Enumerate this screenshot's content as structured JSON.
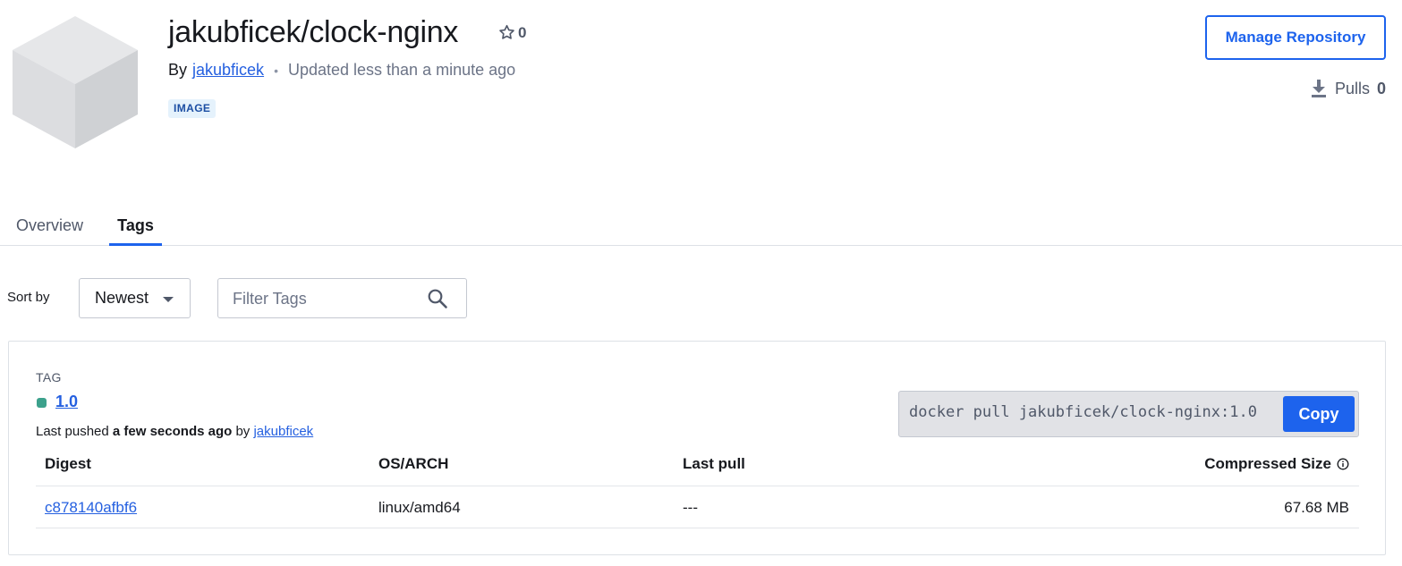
{
  "repo": {
    "name": "jakubficek/clock-nginx",
    "stars": "0",
    "by_label": "By",
    "owner": "jakubficek",
    "updated": "Updated less than a minute ago",
    "badge": "IMAGE",
    "manage_label": "Manage Repository",
    "pulls_label": "Pulls",
    "pulls_count": "0"
  },
  "tabs": [
    {
      "label": "Overview",
      "active": false
    },
    {
      "label": "Tags",
      "active": true
    }
  ],
  "filters": {
    "sort_label": "Sort by",
    "sort_value": "Newest",
    "filter_placeholder": "Filter Tags"
  },
  "tag": {
    "header": "TAG",
    "name": "1.0",
    "status_color": "#3ca18c",
    "pushed_prefix": "Last pushed",
    "pushed_when": "a few seconds ago",
    "pushed_by_label": "by",
    "pushed_by": "jakubficek",
    "pull_command": "docker pull jakubficek/clock-nginx:1.0",
    "copy_label": "Copy",
    "columns": {
      "digest": "Digest",
      "osarch": "OS/ARCH",
      "last_pull": "Last pull",
      "size": "Compressed Size"
    },
    "rows": [
      {
        "digest": "c878140afbf6",
        "osarch": "linux/amd64",
        "last_pull": "---",
        "size": "67.68 MB"
      }
    ]
  },
  "colors": {
    "accent": "#1d63ed",
    "link": "#2560e0"
  },
  "icons": [
    "cube-icon",
    "star-icon",
    "download-icon",
    "caret-down-icon",
    "search-icon",
    "info-icon"
  ]
}
